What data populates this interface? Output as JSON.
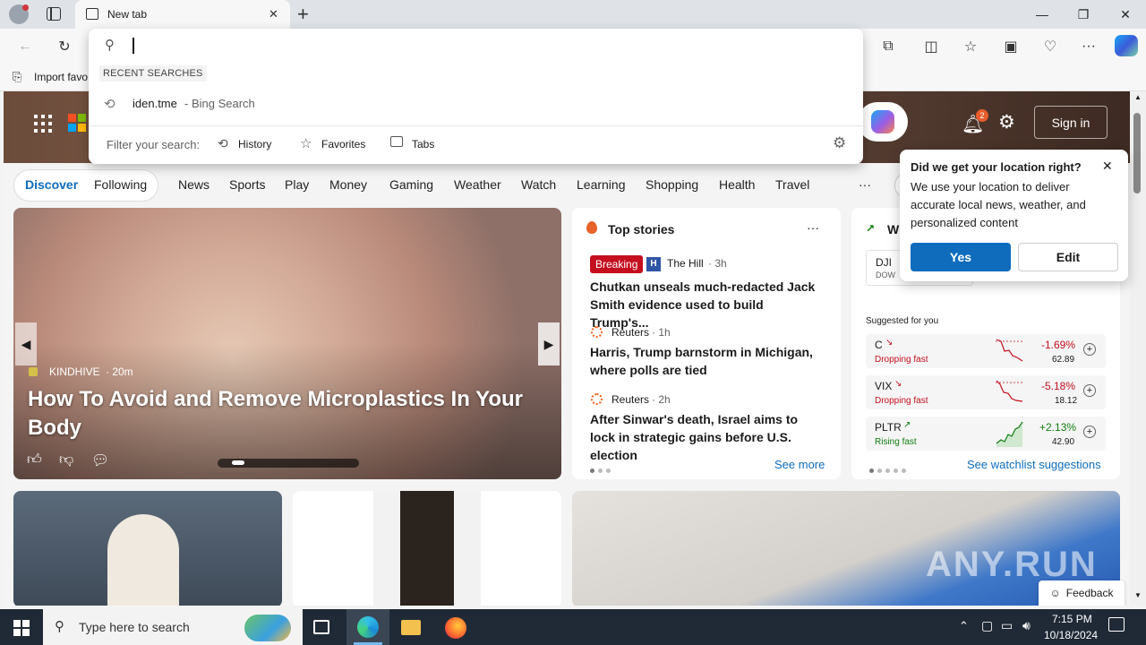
{
  "browser": {
    "tab_title": "New tab",
    "new_tab_symbol": "+",
    "favorites_bar_text": "Import favo",
    "window_controls": {
      "minimize": "—",
      "maximize": "❐",
      "close": "✕"
    }
  },
  "omnibox": {
    "recent_label": "RECENT SEARCHES",
    "recent_query": "iden.tme",
    "recent_engine": "- Bing Search",
    "filter_label": "Filter your search:",
    "filters": [
      "History",
      "Favorites",
      "Tabs"
    ]
  },
  "header": {
    "notification_count": "2",
    "sign_in_label": "Sign in"
  },
  "nav": {
    "pills": [
      "Discover",
      "Following"
    ],
    "tabs": [
      "News",
      "Sports",
      "Play",
      "Money",
      "Gaming",
      "Weather",
      "Watch",
      "Learning",
      "Shopping",
      "Health",
      "Travel"
    ],
    "more": "···"
  },
  "feature": {
    "source": "KINDHIVE",
    "age": "· 20m",
    "headline": "How To Avoid and Remove Microplastics In Your Body"
  },
  "top_stories": {
    "title": "Top stories",
    "more_menu": "···",
    "items": [
      {
        "badge": "Breaking",
        "source": "The Hill",
        "age": "· 3h",
        "headline": "Chutkan unseals much-redacted Jack Smith evidence used to build Trump's..."
      },
      {
        "badge": "",
        "source": "Reuters",
        "age": "· 1h",
        "headline": "Harris, Trump barnstorm in Michigan, where polls are tied"
      },
      {
        "badge": "",
        "source": "Reuters",
        "age": "· 2h",
        "headline": "After Sinwar's death, Israel aims to lock in strategic gains before U.S. election"
      }
    ],
    "see_more": "See more"
  },
  "watchlist": {
    "title_fragment": "W",
    "index_symbol": "DJI",
    "index_name": "DOW",
    "suggested_label": "Suggested for you",
    "stocks": [
      {
        "symbol": "C",
        "status": "Dropping fast",
        "change": "-1.69%",
        "price": "62.89",
        "trend": "down"
      },
      {
        "symbol": "VIX",
        "status": "Dropping fast",
        "change": "-5.18%",
        "price": "18.12",
        "trend": "down"
      },
      {
        "symbol": "PLTR",
        "status": "Rising fast",
        "change": "+2.13%",
        "price": "42.90",
        "trend": "up"
      }
    ],
    "see_suggestions": "See watchlist suggestions"
  },
  "location_popup": {
    "title": "Did we get your location right?",
    "body": "We use your location to deliver accurate local news, weather, and personalized content",
    "yes": "Yes",
    "edit": "Edit"
  },
  "feedback": "Feedback",
  "watermark": "ANY.RUN",
  "taskbar": {
    "search_placeholder": "Type here to search",
    "time": "7:15 PM",
    "date": "10/18/2024"
  },
  "colors": {
    "accent_blue": "#0f6cbd",
    "breaking_red": "#c50f1f",
    "down_red": "#c50f1f",
    "up_green": "#107c10",
    "taskbar": "#202a36"
  }
}
